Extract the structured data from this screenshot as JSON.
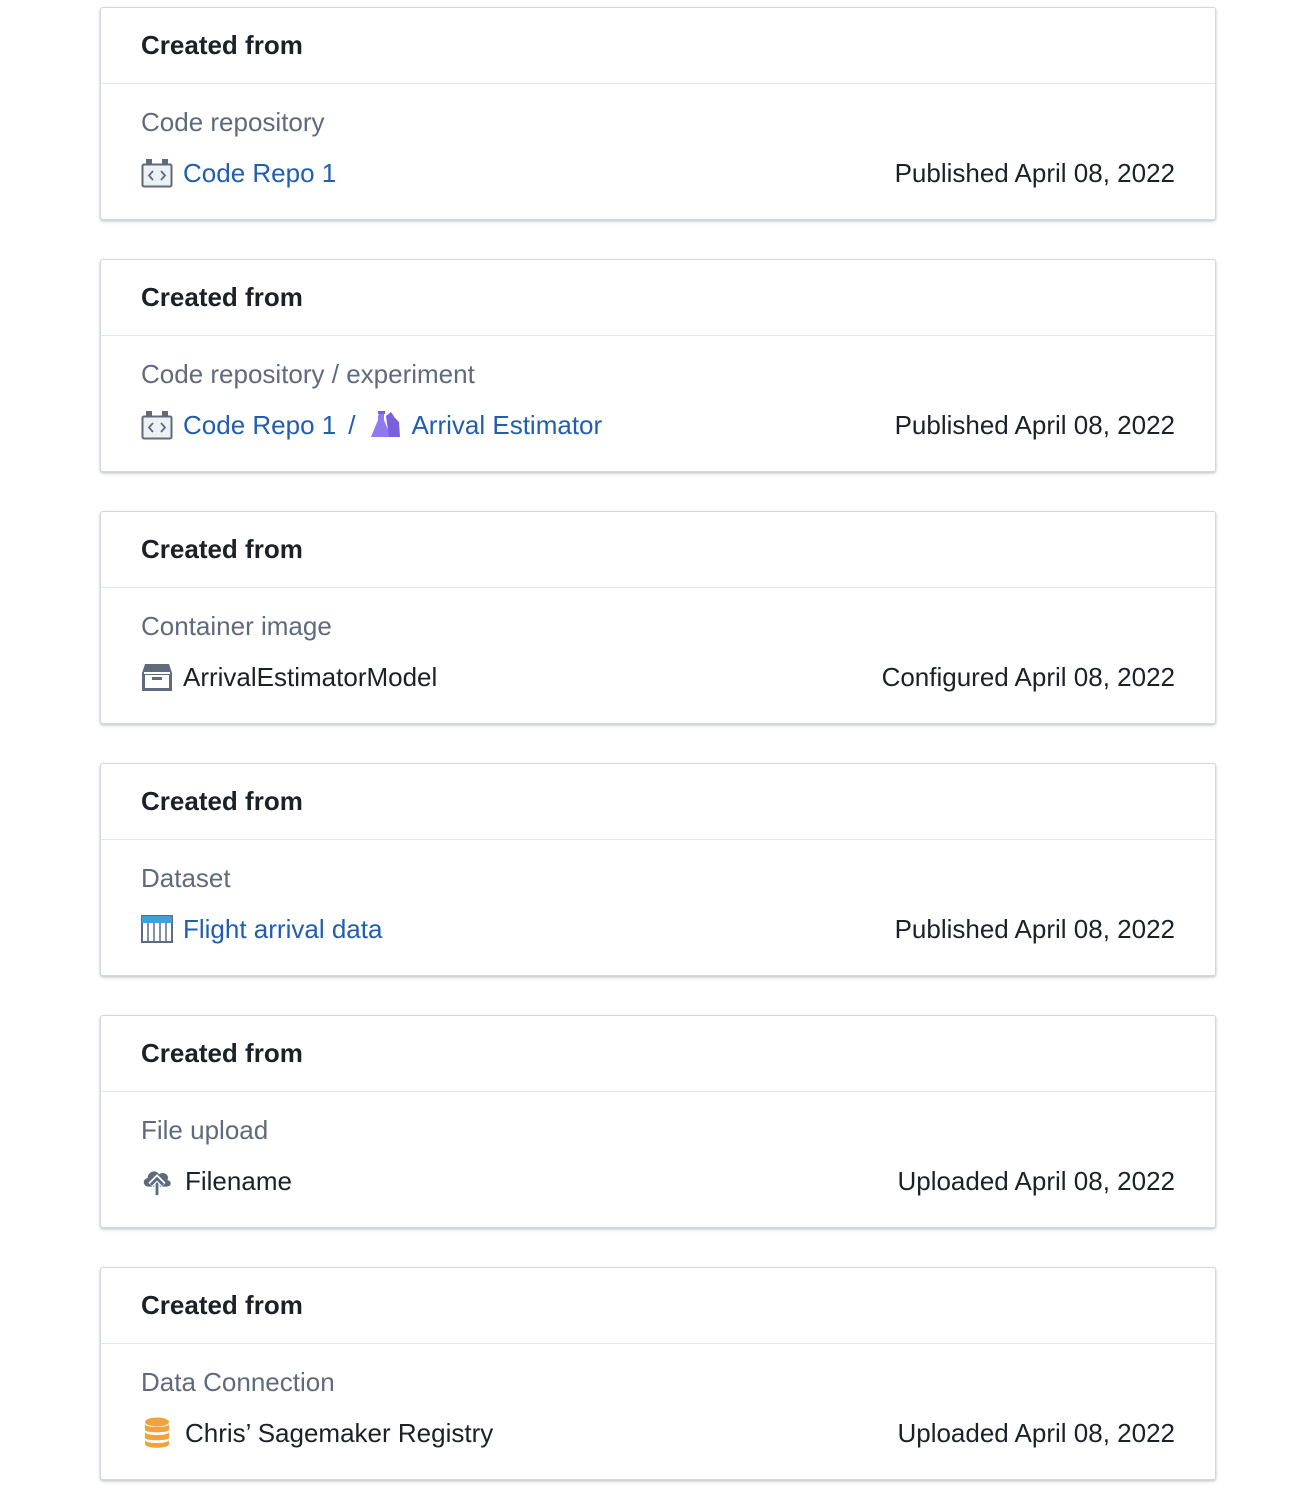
{
  "cards": [
    {
      "title": "Created from",
      "source_type": "Code repository",
      "items": [
        {
          "label": "Code Repo 1",
          "icon": "code-repo-icon"
        }
      ],
      "status": "Published April 08, 2022"
    },
    {
      "title": "Created from",
      "source_type": "Code repository / experiment",
      "items": [
        {
          "label": "Code Repo 1",
          "icon": "code-repo-icon"
        },
        {
          "label": "Arrival Estimator",
          "icon": "experiment-flask-icon"
        }
      ],
      "separator": "/",
      "status": "Published April 08, 2022"
    },
    {
      "title": "Created from",
      "source_type": "Container image",
      "items": [
        {
          "label": "ArrivalEstimatorModel",
          "icon": "container-box-icon"
        }
      ],
      "status": "Configured April 08, 2022"
    },
    {
      "title": "Created from",
      "source_type": "Dataset",
      "items": [
        {
          "label": "Flight arrival data",
          "icon": "dataset-table-icon"
        }
      ],
      "status": "Published April 08, 2022"
    },
    {
      "title": "Created from",
      "source_type": "File upload",
      "items": [
        {
          "label": "Filename",
          "icon": "cloud-upload-icon"
        }
      ],
      "status": "Uploaded April 08, 2022"
    },
    {
      "title": "Created from",
      "source_type": "Data Connection",
      "items": [
        {
          "label": "Chris’ Sagemaker Registry",
          "icon": "database-icon"
        }
      ],
      "status": "Uploaded April 08, 2022"
    }
  ],
  "colors": {
    "link": "#215db0",
    "muted": "#5f6b7c",
    "text": "#1c2127",
    "experiment_icon": "#9179f2",
    "database_icon": "#f0a23c",
    "dataset_icon": "#3fa0de"
  }
}
